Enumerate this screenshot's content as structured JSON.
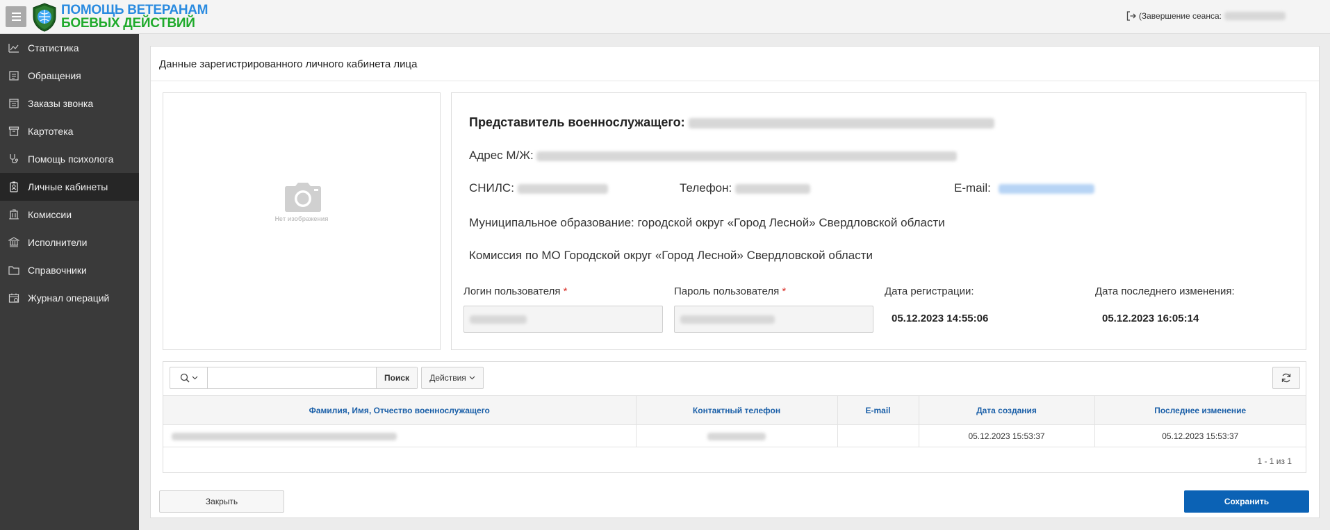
{
  "header": {
    "logo_line1": "ПОМОЩЬ ВЕТЕРАНАМ",
    "logo_line2": "БОЕВЫХ ДЕЙСТВИЙ",
    "logout_label": "(Завершение сеанса:",
    "icons": {
      "menu": "hamburger-icon",
      "logout": "logout-icon"
    }
  },
  "sidebar": {
    "items": [
      {
        "label": "Статистика",
        "icon": "chart-line-icon"
      },
      {
        "label": "Обращения",
        "icon": "inbox-icon"
      },
      {
        "label": "Заказы звонка",
        "icon": "phone-book-icon"
      },
      {
        "label": "Картотека",
        "icon": "archive-icon"
      },
      {
        "label": "Помощь психолога",
        "icon": "stethoscope-icon"
      },
      {
        "label": "Личные кабинеты",
        "icon": "id-badge-icon",
        "active": true
      },
      {
        "label": "Комиссии",
        "icon": "building-icon"
      },
      {
        "label": "Исполнители",
        "icon": "bank-icon"
      },
      {
        "label": "Справочники",
        "icon": "folder-icon"
      },
      {
        "label": "Журнал операций",
        "icon": "calendar-icon"
      }
    ]
  },
  "panel": {
    "title": "Данные зарегистрированного личного кабинета лица",
    "no_image": "Нет изображения"
  },
  "info": {
    "representative_label": "Представитель военнослужащего:",
    "address_label": "Адрес М/Ж:",
    "snils_label": "СНИЛС:",
    "phone_label": "Телефон:",
    "email_label": "E-mail:",
    "municipality": "Муниципальное образование: городской округ «Город Лесной» Свердловской области",
    "commission": "Комиссия по МО Городской округ «Город Лесной» Свердловской области",
    "login_label": "Логин пользователя",
    "password_label": "Пароль пользователя",
    "required_mark": "*",
    "reg_date_label": "Дата регистрации:",
    "reg_date": "05.12.2023 14:55:06",
    "mod_date_label": "Дата последнего изменения:",
    "mod_date": "05.12.2023 16:05:14"
  },
  "grid": {
    "search_button": "Поиск",
    "actions_button": "Действия",
    "columns": [
      "Фамилия, Имя, Отчество военнослужащего",
      "Контактный телефон",
      "E-mail",
      "Дата создания",
      "Последнее изменение"
    ],
    "rows": [
      {
        "created": "05.12.2023 15:53:37",
        "modified": "05.12.2023 15:53:37"
      }
    ],
    "pagination": "1 - 1 из 1"
  },
  "footer": {
    "close_button": "Закрыть",
    "save_button": "Сохранить"
  },
  "colors": {
    "sidebar_bg": "#3a3a3a",
    "accent_blue": "#0b62b5",
    "logo_blue": "#2a8be0",
    "logo_green": "#1faa2b"
  }
}
